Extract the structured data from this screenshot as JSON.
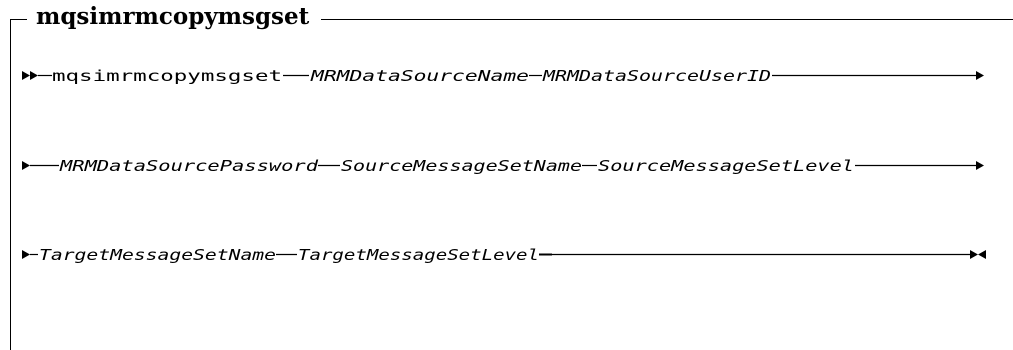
{
  "title": "mqsimrmcopymsgset",
  "rows": [
    {
      "command": "mqsimrmcopymsgset",
      "params": [
        "MRMDataSourceName",
        "MRMDataSourceUserID"
      ]
    },
    {
      "params": [
        "MRMDataSourcePassword",
        "SourceMessageSetName",
        "SourceMessageSetLevel"
      ]
    },
    {
      "params": [
        "TargetMessageSetName",
        "TargetMessageSetLevel"
      ]
    }
  ]
}
